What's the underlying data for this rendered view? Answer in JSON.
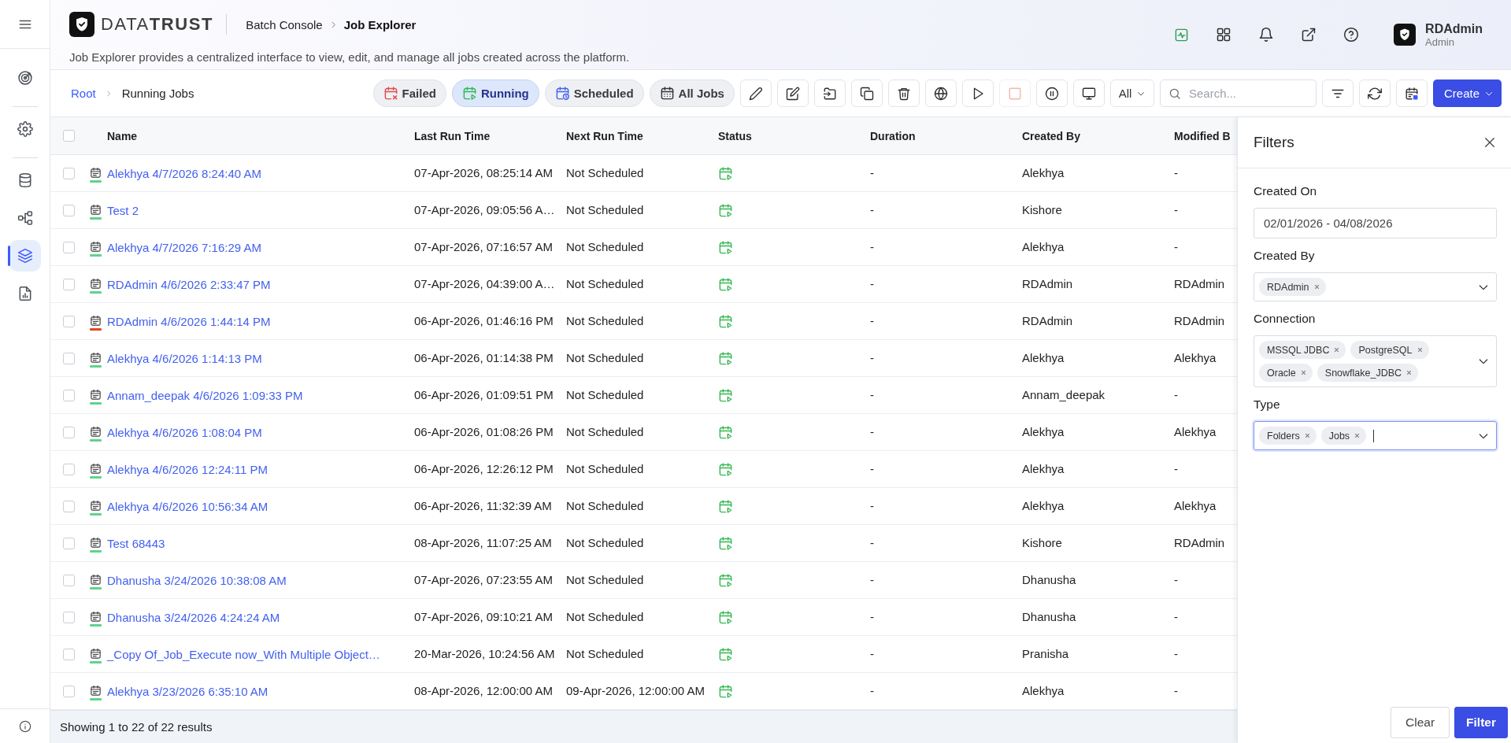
{
  "sidebar": {
    "groups": [
      {
        "items": [
          {
            "kind": "target",
            "selected": false
          }
        ]
      },
      {
        "items": [
          {
            "kind": "gear",
            "selected": false
          }
        ]
      },
      {
        "items": [
          {
            "kind": "database",
            "selected": false
          },
          {
            "kind": "nodes",
            "selected": false
          },
          {
            "kind": "layers",
            "selected": true
          },
          {
            "kind": "report",
            "selected": false
          }
        ]
      }
    ]
  },
  "header": {
    "logo": "DATA**TRUST**",
    "breadcrumb": [
      {
        "label": "Batch Console",
        "current": false
      },
      {
        "label": "Job Explorer",
        "current": true
      }
    ],
    "description": "Job Explorer provides a centralized interface to view, edit, and manage all jobs created across the platform.",
    "user": {
      "name": "RDAdmin",
      "role": "Admin"
    }
  },
  "toolbar": {
    "path": [
      {
        "label": "Root",
        "link": true
      },
      {
        "label": "Running Jobs",
        "link": false
      }
    ],
    "quick_filters": [
      {
        "label": "Failed",
        "kind": "failed",
        "selected": false
      },
      {
        "label": "Running",
        "kind": "running",
        "selected": true
      },
      {
        "label": "Scheduled",
        "kind": "scheduled",
        "selected": false
      },
      {
        "label": "All Jobs",
        "kind": "all",
        "selected": false
      }
    ],
    "actions": [
      {
        "kind": "pencil",
        "disabled": false
      },
      {
        "kind": "note",
        "disabled": false
      },
      {
        "kind": "move",
        "disabled": false
      },
      {
        "kind": "copy",
        "disabled": false
      },
      {
        "kind": "delete",
        "disabled": false
      },
      {
        "kind": "globe",
        "disabled": false
      },
      {
        "kind": "run",
        "disabled": false
      },
      {
        "kind": "stop",
        "disabled": true
      },
      {
        "kind": "pause",
        "disabled": false
      },
      {
        "kind": "monitor",
        "disabled": false
      }
    ],
    "scope": {
      "value": "All"
    },
    "search": {
      "placeholder": "Search..."
    },
    "create": {
      "label": "Create"
    }
  },
  "table": {
    "select_all": {
      "checked": false
    },
    "columns": [
      "Name",
      "Last Run Time",
      "Next Run Time",
      "Status",
      "Duration",
      "Created By",
      "Modified B"
    ],
    "rows": [
      {
        "checked": false,
        "name": "Alekhya 4/7/2026 8:24:40 AM",
        "color": "#5fd38d",
        "last_run": "07-Apr-2026, 08:25:14 AM",
        "next_run": "Not Scheduled",
        "running": true,
        "duration": "-",
        "created_by": "Alekhya",
        "modified_by": "-"
      },
      {
        "checked": false,
        "name": "Test 2",
        "color": "#5fd38d",
        "last_run": "07-Apr-2026, 09:05:56 A…",
        "next_run": "Not Scheduled",
        "running": true,
        "duration": "-",
        "created_by": "Kishore",
        "modified_by": "-"
      },
      {
        "checked": false,
        "name": "Alekhya 4/7/2026 7:16:29 AM",
        "color": "#5fd38d",
        "last_run": "07-Apr-2026, 07:16:57 AM",
        "next_run": "Not Scheduled",
        "running": true,
        "duration": "-",
        "created_by": "Alekhya",
        "modified_by": "-"
      },
      {
        "checked": false,
        "name": "RDAdmin 4/6/2026 2:33:47 PM",
        "color": "#5fd38d",
        "last_run": "07-Apr-2026, 04:39:00 A…",
        "next_run": "Not Scheduled",
        "running": true,
        "duration": "-",
        "created_by": "RDAdmin",
        "modified_by": "RDAdmin"
      },
      {
        "checked": false,
        "name": "RDAdmin 4/6/2026 1:44:14 PM",
        "color": "#e8461e",
        "last_run": "06-Apr-2026, 01:46:16 PM",
        "next_run": "Not Scheduled",
        "running": true,
        "duration": "-",
        "created_by": "RDAdmin",
        "modified_by": "RDAdmin"
      },
      {
        "checked": false,
        "name": "Alekhya 4/6/2026 1:14:13 PM",
        "color": "#5fd38d",
        "last_run": "06-Apr-2026, 01:14:38 PM",
        "next_run": "Not Scheduled",
        "running": true,
        "duration": "-",
        "created_by": "Alekhya",
        "modified_by": "Alekhya"
      },
      {
        "checked": false,
        "name": "Annam_deepak 4/6/2026 1:09:33 PM",
        "color": "#5fd38d",
        "last_run": "06-Apr-2026, 01:09:51 PM",
        "next_run": "Not Scheduled",
        "running": true,
        "duration": "-",
        "created_by": "Annam_deepak",
        "modified_by": "-"
      },
      {
        "checked": false,
        "name": "Alekhya 4/6/2026 1:08:04 PM",
        "color": "#5fd38d",
        "last_run": "06-Apr-2026, 01:08:26 PM",
        "next_run": "Not Scheduled",
        "running": true,
        "duration": "-",
        "created_by": "Alekhya",
        "modified_by": "Alekhya"
      },
      {
        "checked": false,
        "name": "Alekhya 4/6/2026 12:24:11 PM",
        "color": "#5fd38d",
        "last_run": "06-Apr-2026, 12:26:12 PM",
        "next_run": "Not Scheduled",
        "running": true,
        "duration": "-",
        "created_by": "Alekhya",
        "modified_by": "-"
      },
      {
        "checked": false,
        "name": "Alekhya 4/6/2026 10:56:34 AM",
        "color": "#5fd38d",
        "last_run": "06-Apr-2026, 11:32:39 AM",
        "next_run": "Not Scheduled",
        "running": true,
        "duration": "-",
        "created_by": "Alekhya",
        "modified_by": "Alekhya"
      },
      {
        "checked": false,
        "name": "Test 68443",
        "color": "#5fd38d",
        "last_run": "08-Apr-2026, 11:07:25 AM",
        "next_run": "Not Scheduled",
        "running": true,
        "duration": "-",
        "created_by": "Kishore",
        "modified_by": "RDAdmin"
      },
      {
        "checked": false,
        "name": "Dhanusha 3/24/2026 10:38:08 AM",
        "color": "#5fd38d",
        "last_run": "07-Apr-2026, 07:23:55 AM",
        "next_run": "Not Scheduled",
        "running": true,
        "duration": "-",
        "created_by": "Dhanusha",
        "modified_by": "-"
      },
      {
        "checked": false,
        "name": "Dhanusha 3/24/2026 4:24:24 AM",
        "color": "#5fd38d",
        "last_run": "07-Apr-2026, 09:10:21 AM",
        "next_run": "Not Scheduled",
        "running": true,
        "duration": "-",
        "created_by": "Dhanusha",
        "modified_by": "-"
      },
      {
        "checked": false,
        "name": "_Copy Of_Job_Execute now_With Multiple Object…",
        "color": "#5fd38d",
        "last_run": "20-Mar-2026, 10:24:56 AM",
        "next_run": "Not Scheduled",
        "running": true,
        "duration": "-",
        "created_by": "Pranisha",
        "modified_by": "-"
      },
      {
        "checked": false,
        "name": "Alekhya 3/23/2026 6:35:10 AM",
        "color": "#5fd38d",
        "last_run": "08-Apr-2026, 12:00:00 AM",
        "next_run": "09-Apr-2026, 12:00:00 AM",
        "running": true,
        "duration": "-",
        "created_by": "Alekhya",
        "modified_by": "-"
      }
    ]
  },
  "footer": {
    "summary": "Showing 1 to 22 of 22 results"
  },
  "filters": {
    "title": "Filters",
    "fields": [
      {
        "label": "Created On",
        "kind": "date",
        "value": "02/01/2026 - 04/08/2026",
        "focused": false
      },
      {
        "label": "Created By",
        "kind": "multi",
        "chips": [
          "RDAdmin"
        ],
        "focused": false
      },
      {
        "label": "Connection",
        "kind": "multi",
        "chips": [
          "MSSQL JDBC",
          "PostgreSQL",
          "Oracle",
          "Snowflake_JDBC"
        ],
        "focused": false
      },
      {
        "label": "Type",
        "kind": "multi",
        "chips": [
          "Folders",
          "Jobs"
        ],
        "focused": true
      }
    ],
    "buttons": [
      {
        "label": "Clear",
        "kind": "secondary"
      },
      {
        "label": "Filter",
        "kind": "primary"
      }
    ]
  }
}
